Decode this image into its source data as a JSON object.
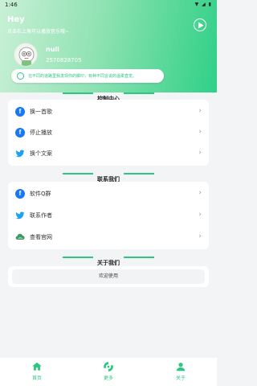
{
  "status": {
    "time": "1:46",
    "icons": "▼ ◢ ▮"
  },
  "header": {
    "title": "Hey",
    "subtitle": "点击右上角可以播放音乐哦~"
  },
  "user": {
    "name": "null",
    "id": "2570828705"
  },
  "notice": {
    "text": "在不同的道路里我发现你的脚印，有种不同言说的温柔直觉。"
  },
  "sections": {
    "control": "控制中心",
    "contact": "联系我们",
    "about": "关于我们"
  },
  "control_items": [
    {
      "label": "换一首歌",
      "icon": "facebook-icon"
    },
    {
      "label": "停止播放",
      "icon": "facebook-icon"
    },
    {
      "label": "换个文案",
      "icon": "twitter-icon"
    }
  ],
  "contact_items": [
    {
      "label": "软件Q群",
      "icon": "facebook-icon"
    },
    {
      "label": "联系作者",
      "icon": "twitter-icon"
    },
    {
      "label": "查看官网",
      "icon": "cloud-icon"
    }
  ],
  "about": {
    "button": "欢迎使用"
  },
  "nav": [
    {
      "label": "首页",
      "icon": "home-icon"
    },
    {
      "label": "更多",
      "icon": "more-icon"
    },
    {
      "label": "关于",
      "icon": "person-icon"
    }
  ],
  "colors": {
    "accent": "#2fc583",
    "facebook": "#1877f2",
    "twitter": "#1da1f2"
  }
}
